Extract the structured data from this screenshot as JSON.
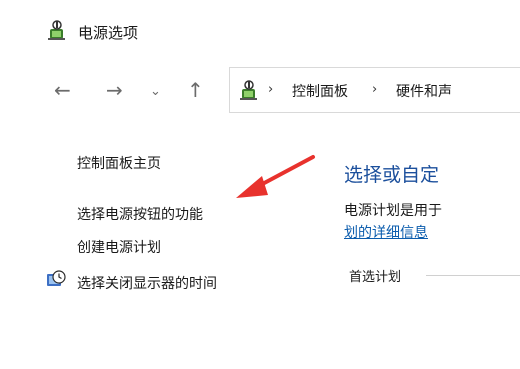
{
  "window": {
    "title": "电源选项"
  },
  "nav": {
    "back": "←",
    "forward": "→",
    "recent": "⌄",
    "up": "↑"
  },
  "address": {
    "separator": "›",
    "crumbs": [
      "控制面板",
      "硬件和声"
    ]
  },
  "sidebar": {
    "items": [
      {
        "label": "控制面板主页"
      },
      {
        "label": "选择电源按钮的功能"
      },
      {
        "label": "创建电源计划"
      },
      {
        "label": "选择关闭显示器的时间"
      }
    ]
  },
  "main": {
    "heading": "选择或自定",
    "description": "电源计划是用于",
    "link": "划的详细信息",
    "plan_label": "首选计划"
  },
  "colors": {
    "annotation_arrow": "#e8322d",
    "heading": "#1b4f9c",
    "link": "#0b5cad"
  }
}
